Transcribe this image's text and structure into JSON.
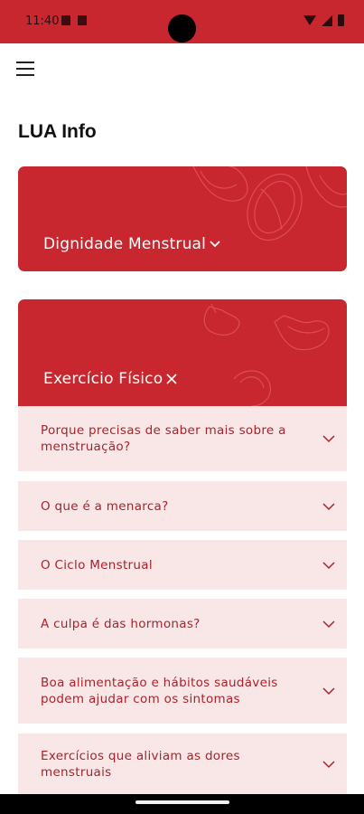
{
  "status_bar": {
    "time": "11:40",
    "icons": [
      "sim-card-icon",
      "notification-icon",
      "wifi-icon",
      "signal-icon",
      "battery-icon"
    ]
  },
  "header": {
    "menu_icon": "hamburger-menu-icon",
    "title": "LUA Info"
  },
  "sections": [
    {
      "title": "Dignidade Menstrual",
      "state": "collapsed",
      "toggle_icon": "chevron-down-icon"
    },
    {
      "title": "Exercício Físico",
      "state": "expanded",
      "toggle_icon": "close-icon"
    }
  ],
  "accordion": {
    "items": [
      "Porque precisas de saber mais sobre a menstruação?",
      "O que é a menarca?",
      "O Ciclo Menstrual",
      "A culpa é das hormonas?",
      "Boa alimentação e hábitos saudáveis podem ajudar com os sintomas",
      "Exercícios que aliviam as dores menstruais"
    ],
    "item_icon": "chevron-down-icon"
  },
  "colors": {
    "brand_red": "#c8272f",
    "item_background": "#f9e7e8",
    "item_text": "#a8232b"
  }
}
